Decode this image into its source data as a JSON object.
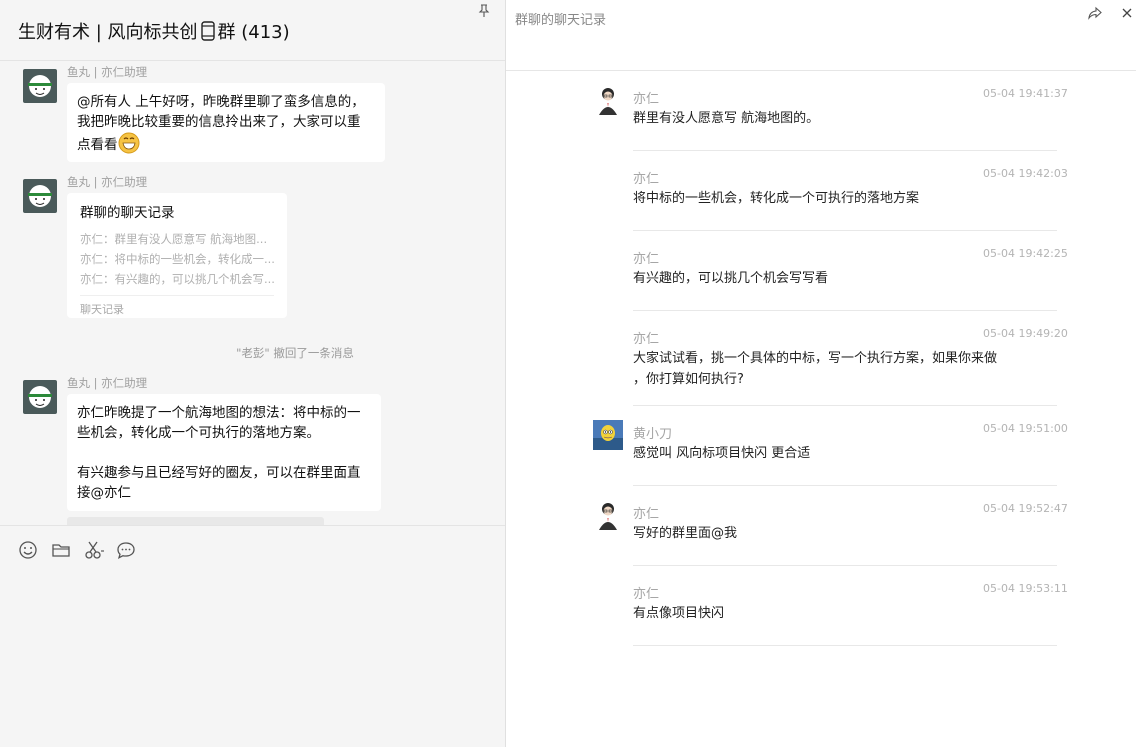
{
  "chat": {
    "title_prefix": "生财有术 | 风向标共创",
    "title_suffix": "群 (413)"
  },
  "messages": [
    {
      "sender": "鱼丸 | 亦仁助理",
      "text_line1": "@所有人 上午好呀，昨晚群里聊了蛮多信息的，",
      "text_line2": "我把昨晚比较重要的信息拎出来了，大家可以重",
      "text_line3": "点看看"
    },
    {
      "sender": "鱼丸 | 亦仁助理",
      "card": {
        "title": "群聊的聊天记录",
        "lines": [
          "亦仁：群里有没人愿意写 航海地图...",
          "亦仁：将中标的一些机会，转化成一...",
          "亦仁：有兴趣的，可以挑几个机会写..."
        ],
        "footer": "聊天记录"
      }
    },
    {
      "sender": "鱼丸 | 亦仁助理",
      "text_line1": "亦仁昨晚提了一个航海地图的想法：将中标的一",
      "text_line2": "些机会，转化成一个可执行的落地方案。",
      "text_line3": "有兴趣参与且已经写好的圈友，可以在群里面直",
      "text_line4": "接@亦仁"
    }
  ],
  "recall_notice": "\"老彭\" 撤回了一条消息",
  "toolbar": {
    "icons": [
      "emoji-icon",
      "folder-icon",
      "scissors-icon",
      "chat-bubble-icon"
    ]
  },
  "history": {
    "title": "群聊的聊天记录",
    "records": [
      {
        "name": "亦仁",
        "time": "05-04 19:41:37",
        "lines": [
          "群里有没人愿意写 航海地图的。"
        ],
        "avatar": "yiren"
      },
      {
        "name": "亦仁",
        "time": "05-04 19:42:03",
        "lines": [
          "将中标的一些机会，转化成一个可执行的落地方案"
        ],
        "avatar": ""
      },
      {
        "name": "亦仁",
        "time": "05-04 19:42:25",
        "lines": [
          "有兴趣的，可以挑几个机会写写看"
        ],
        "avatar": ""
      },
      {
        "name": "亦仁",
        "time": "05-04 19:49:20",
        "lines": [
          "大家试试看，挑一个具体的中标，写一个执行方案，如果你来做",
          "，你打算如何执行?"
        ],
        "avatar": ""
      },
      {
        "name": "黄小刀",
        "time": "05-04 19:51:00",
        "lines": [
          "感觉叫 风向标项目快闪 更合适"
        ],
        "avatar": "huang"
      },
      {
        "name": "亦仁",
        "time": "05-04 19:52:47",
        "lines": [
          "写好的群里面@我"
        ],
        "avatar": "yiren"
      },
      {
        "name": "亦仁",
        "time": "05-04 19:53:11",
        "lines": [
          "有点像项目快闪"
        ],
        "avatar": ""
      }
    ]
  }
}
